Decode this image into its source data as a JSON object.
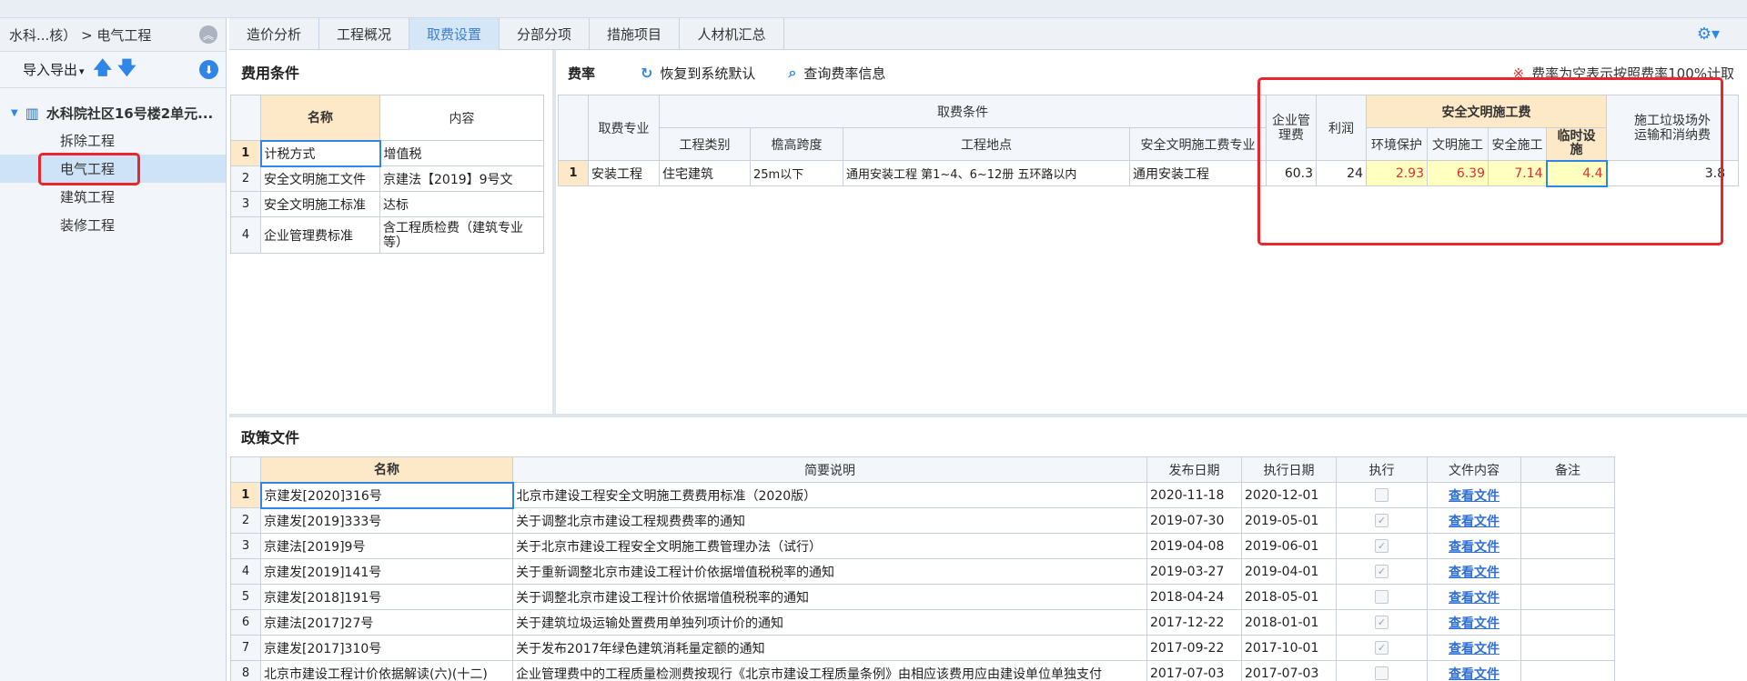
{
  "sidebar": {
    "breadcrumb": "水科...核） > 电气工程",
    "toolbar": {
      "import_export": "导入导出"
    },
    "tree": {
      "root": "水科院社区16号楼2单元...",
      "items": [
        {
          "label": "拆除工程"
        },
        {
          "label": "电气工程"
        },
        {
          "label": "建筑工程"
        },
        {
          "label": "装修工程"
        }
      ]
    }
  },
  "tabs": [
    {
      "label": "造价分析"
    },
    {
      "label": "工程概况"
    },
    {
      "label": "取费设置"
    },
    {
      "label": "分部分项"
    },
    {
      "label": "措施项目"
    },
    {
      "label": "人材机汇总"
    }
  ],
  "cost_conditions": {
    "title": "费用条件",
    "headers": {
      "name": "名称",
      "content": "内容"
    },
    "rows": [
      {
        "idx": "1",
        "name": "计税方式",
        "content": "增值税"
      },
      {
        "idx": "2",
        "name": "安全文明施工文件",
        "content": "京建法【2019】9号文"
      },
      {
        "idx": "3",
        "name": "安全文明施工标准",
        "content": "达标"
      },
      {
        "idx": "4",
        "name": "企业管理费标准",
        "content_line1": "含工程质检费（建筑专业",
        "content_line2": "等）"
      }
    ]
  },
  "rates": {
    "title": "费率",
    "restore_btn": "恢复到系统默认",
    "query_btn": "查询费率信息",
    "note": "费率为空表示按照费率100%计取",
    "headers": {
      "specialty": "取费专业",
      "conditions": "取费条件",
      "project_type": "工程类别",
      "eave_span": "檐高跨度",
      "location": "工程地点",
      "safety_specialty": "安全文明施工费专业",
      "mgmt_fee_line1": "企业管",
      "mgmt_fee_line2": "理费",
      "profit": "利润",
      "safety_group": "安全文明施工费",
      "env": "环境保护",
      "civil": "文明施工",
      "safe": "安全施工",
      "temp_line1": "临时设",
      "temp_line2": "施",
      "waste_line1": "施工垃圾场外",
      "waste_line2": "运输和消纳费"
    },
    "rows": [
      {
        "idx": "1",
        "specialty": "安装工程",
        "project_type": "住宅建筑",
        "eave_span": "25m以下",
        "location": "通用安装工程 第1~4、6~12册 五环路以内",
        "safety_specialty": "通用安装工程",
        "mgmt_fee": "60.3",
        "profit": "24",
        "env": "2.93",
        "civil": "6.39",
        "safe": "7.14",
        "temp": "4.4",
        "waste": "3.8"
      }
    ]
  },
  "policy": {
    "title": "政策文件",
    "headers": {
      "name": "名称",
      "summary": "简要说明",
      "publish": "发布日期",
      "effective": "执行日期",
      "execute": "执行",
      "content": "文件内容",
      "remark": "备注"
    },
    "rows": [
      {
        "idx": "1",
        "name": "京建发[2020]316号",
        "summary": "北京市建设工程安全文明施工费费用标准（2020版）",
        "publish": "2020-11-18",
        "effective": "2020-12-01",
        "checked": false,
        "link": "查看文件"
      },
      {
        "idx": "2",
        "name": "京建发[2019]333号",
        "summary": "关于调整北京市建设工程规费费率的通知",
        "publish": "2019-07-30",
        "effective": "2019-05-01",
        "checked": true,
        "link": "查看文件"
      },
      {
        "idx": "3",
        "name": "京建法[2019]9号",
        "summary": "关于北京市建设工程安全文明施工费管理办法（试行）",
        "publish": "2019-04-08",
        "effective": "2019-06-01",
        "checked": true,
        "link": "查看文件"
      },
      {
        "idx": "4",
        "name": "京建发[2019]141号",
        "summary": "关于重新调整北京市建设工程计价依据增值税税率的通知",
        "publish": "2019-03-27",
        "effective": "2019-04-01",
        "checked": true,
        "link": "查看文件"
      },
      {
        "idx": "5",
        "name": "京建发[2018]191号",
        "summary": "关于调整北京市建设工程计价依据增值税税率的通知",
        "publish": "2018-04-24",
        "effective": "2018-05-01",
        "checked": false,
        "link": "查看文件"
      },
      {
        "idx": "6",
        "name": "京建法[2017]27号",
        "summary": "关于建筑垃圾运输处置费用单独列项计价的通知",
        "publish": "2017-12-22",
        "effective": "2018-01-01",
        "checked": true,
        "link": "查看文件"
      },
      {
        "idx": "7",
        "name": "京建发[2017]310号",
        "summary": "关于发布2017年绿色建筑消耗量定额的通知",
        "publish": "2017-09-22",
        "effective": "2017-10-01",
        "checked": true,
        "link": "查看文件"
      },
      {
        "idx": "8",
        "name": "北京市建设工程计价依据解读(六)(十二)",
        "summary": "企业管理费中的工程质量检测费按现行《北京市建设工程质量条例》由相应该费用应由建设单位单独支付",
        "publish": "2017-07-03",
        "effective": "2017-07-03",
        "checked": false,
        "link": "查看文件"
      }
    ]
  }
}
